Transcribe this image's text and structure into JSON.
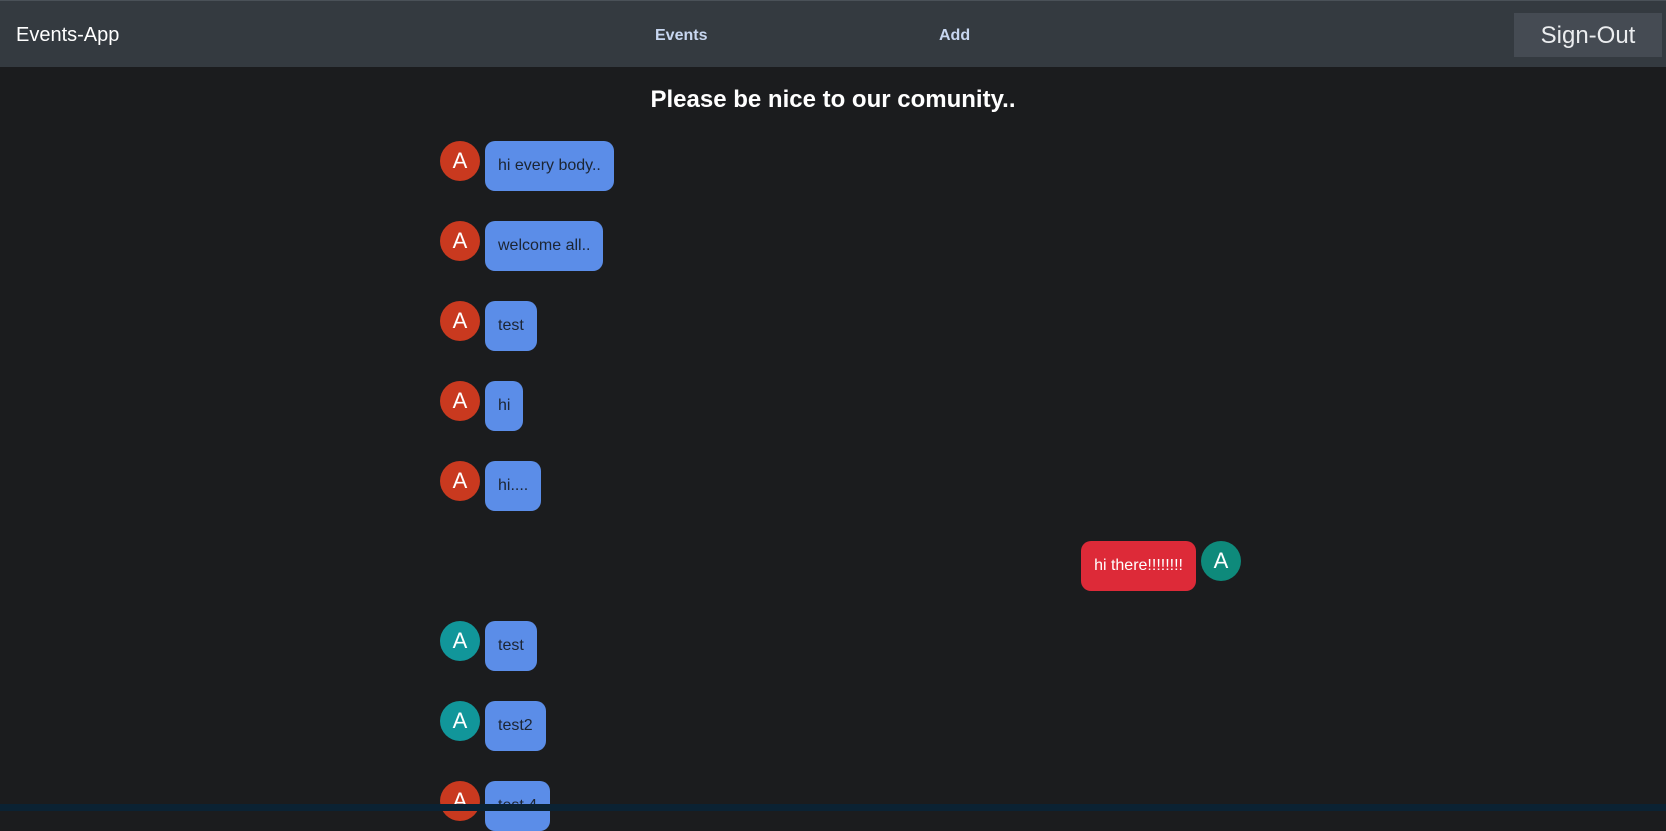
{
  "navbar": {
    "brand": "Events-App",
    "links": [
      "Events",
      "Add"
    ],
    "signout_label": "Sign-Out"
  },
  "page_title": "Please be nice to our comunity..",
  "colors": {
    "avatar_red": "#c9391f",
    "avatar_teal": "#11969a",
    "avatar_green": "#0e8a7b",
    "bubble_blue": "#5b8de8",
    "bubble_red": "#dd2a38"
  },
  "messages": [
    {
      "side": "left",
      "avatar": "A",
      "avatar_color": "#c9391f",
      "text": "hi every body.."
    },
    {
      "side": "left",
      "avatar": "A",
      "avatar_color": "#c9391f",
      "text": "welcome all.."
    },
    {
      "side": "left",
      "avatar": "A",
      "avatar_color": "#c9391f",
      "text": "test"
    },
    {
      "side": "left",
      "avatar": "A",
      "avatar_color": "#c9391f",
      "text": "hi"
    },
    {
      "side": "left",
      "avatar": "A",
      "avatar_color": "#c9391f",
      "text": "hi...."
    },
    {
      "side": "right",
      "avatar": "A",
      "avatar_color": "#0e8a7b",
      "text": "hi there!!!!!!!!"
    },
    {
      "side": "left",
      "avatar": "A",
      "avatar_color": "#11969a",
      "text": "test"
    },
    {
      "side": "left",
      "avatar": "A",
      "avatar_color": "#11969a",
      "text": "test2"
    },
    {
      "side": "left",
      "avatar": "A",
      "avatar_color": "#c9391f",
      "text": "test 4"
    }
  ]
}
